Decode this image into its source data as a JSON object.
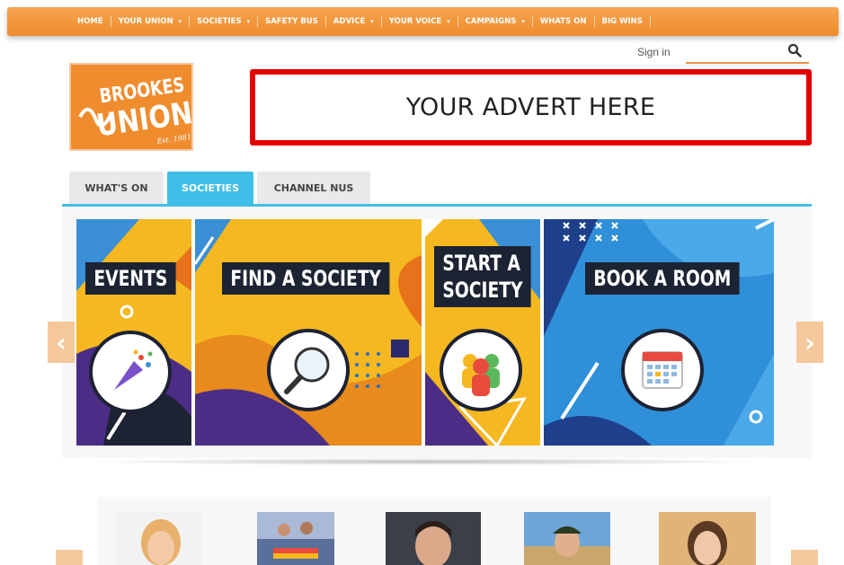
{
  "nav": {
    "items": [
      {
        "label": "HOME",
        "dropdown": false
      },
      {
        "label": "YOUR UNION",
        "dropdown": true
      },
      {
        "label": "SOCIETIES",
        "dropdown": true
      },
      {
        "label": "SAFETY BUS",
        "dropdown": false
      },
      {
        "label": "ADVICE",
        "dropdown": true
      },
      {
        "label": "YOUR VOICE",
        "dropdown": true
      },
      {
        "label": "CAMPAIGNS",
        "dropdown": true
      },
      {
        "label": "WHATS ON",
        "dropdown": false
      },
      {
        "label": "BIG WINS",
        "dropdown": false
      }
    ],
    "caret": "▾"
  },
  "header": {
    "signin_label": "Sign in",
    "search_placeholder": "",
    "logo_line1": "BROOKES",
    "logo_line2": "UNION",
    "logo_est": "Est. 1981",
    "advert_text": "YOUR ADVERT HERE"
  },
  "tabs": [
    {
      "label": "WHAT'S ON",
      "active": false
    },
    {
      "label": "SOCIETIES",
      "active": true
    },
    {
      "label": "CHANNEL NUS",
      "active": false
    }
  ],
  "carousel": {
    "prev_glyph": "‹",
    "next_glyph": "›",
    "panels": [
      {
        "label": "EVENTS",
        "icon": "party-popper-icon"
      },
      {
        "label": "FIND A SOCIETY",
        "icon": "magnifier-icon"
      },
      {
        "label_line1": "START A",
        "label_line2": "SOCIETY",
        "icon": "people-group-icon"
      },
      {
        "label": "BOOK A ROOM",
        "icon": "calendar-icon"
      }
    ]
  },
  "colors": {
    "brand_orange": "#ef8c2e",
    "accent_blue": "#3fbfe8",
    "advert_border": "#e50000",
    "panel_dark": "#1c2333",
    "panel_yellow": "#f5b820"
  }
}
